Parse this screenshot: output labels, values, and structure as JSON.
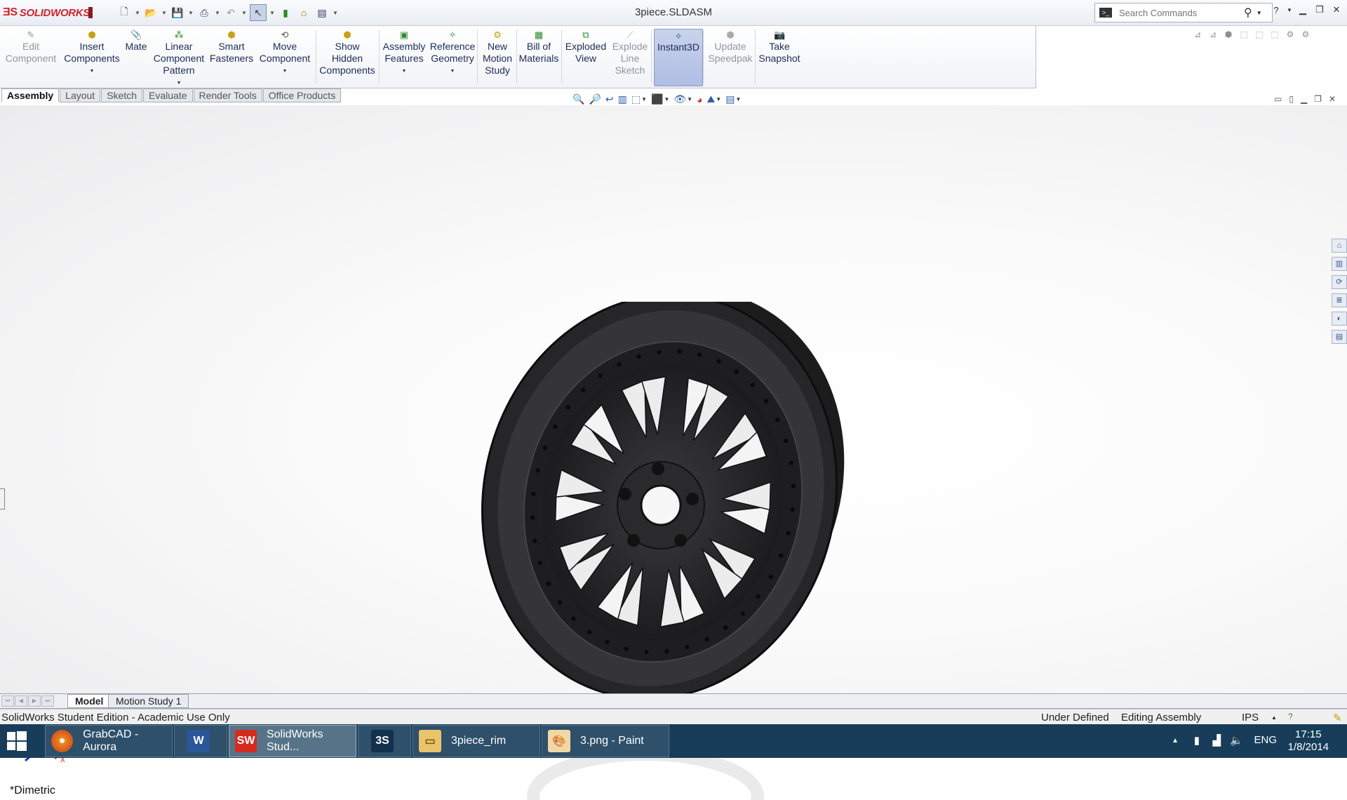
{
  "app": {
    "logo_text": "SOLIDWORKS",
    "document_title": "3piece.SLDASM"
  },
  "search": {
    "placeholder": "Search Commands"
  },
  "ribbon": {
    "buttons": [
      {
        "label": "Edit\nComponent",
        "icon": "edit-component-icon",
        "enabled": false
      },
      {
        "label": "Insert\nComponents",
        "icon": "insert-components-icon",
        "enabled": true
      },
      {
        "label": "Mate",
        "icon": "mate-icon",
        "enabled": true
      },
      {
        "label": "Linear\nComponent\nPattern",
        "icon": "linear-pattern-icon",
        "enabled": true
      },
      {
        "label": "Smart\nFasteners",
        "icon": "smart-fasteners-icon",
        "enabled": true
      },
      {
        "label": "Move\nComponent",
        "icon": "move-component-icon",
        "enabled": true
      },
      {
        "label": "Show\nHidden\nComponents",
        "icon": "show-hidden-icon",
        "enabled": true
      },
      {
        "label": "Assembly\nFeatures",
        "icon": "assembly-features-icon",
        "enabled": true
      },
      {
        "label": "Reference\nGeometry",
        "icon": "reference-geometry-icon",
        "enabled": true
      },
      {
        "label": "New\nMotion\nStudy",
        "icon": "motion-study-icon",
        "enabled": true
      },
      {
        "label": "Bill of\nMaterials",
        "icon": "bom-icon",
        "enabled": true
      },
      {
        "label": "Exploded\nView",
        "icon": "exploded-view-icon",
        "enabled": true
      },
      {
        "label": "Explode\nLine\nSketch",
        "icon": "explode-line-icon",
        "enabled": false
      },
      {
        "label": "Instant3D",
        "icon": "instant3d-icon",
        "enabled": true,
        "active": true
      },
      {
        "label": "Update\nSpeedpak",
        "icon": "speedpak-icon",
        "enabled": false
      },
      {
        "label": "Take\nSnapshot",
        "icon": "snapshot-icon",
        "enabled": true
      }
    ]
  },
  "tabs": [
    "Assembly",
    "Layout",
    "Sketch",
    "Evaluate",
    "Render Tools",
    "Office Products"
  ],
  "viewport": {
    "view_label": "*Dimetric",
    "triad_x": "X",
    "triad_y": "Y"
  },
  "model_tabs": [
    "Model",
    "Motion Study 1"
  ],
  "status": {
    "edition": "SolidWorks Student Edition - Academic Use Only",
    "definition": "Under Defined",
    "mode": "Editing Assembly",
    "units": "IPS"
  },
  "taskbar": {
    "items": [
      {
        "label": "GrabCAD - Aurora",
        "icon": "firefox-icon"
      },
      {
        "label": "",
        "icon": "word-icon"
      },
      {
        "label": "SolidWorks Stud...",
        "icon": "solidworks-icon",
        "active": true
      },
      {
        "label": "",
        "icon": "3ds-icon"
      },
      {
        "label": "3piece_rim",
        "icon": "folder-icon"
      },
      {
        "label": "3.png - Paint",
        "icon": "paint-icon"
      }
    ],
    "lang": "ENG",
    "time": "17:15",
    "date": "1/8/2014"
  }
}
